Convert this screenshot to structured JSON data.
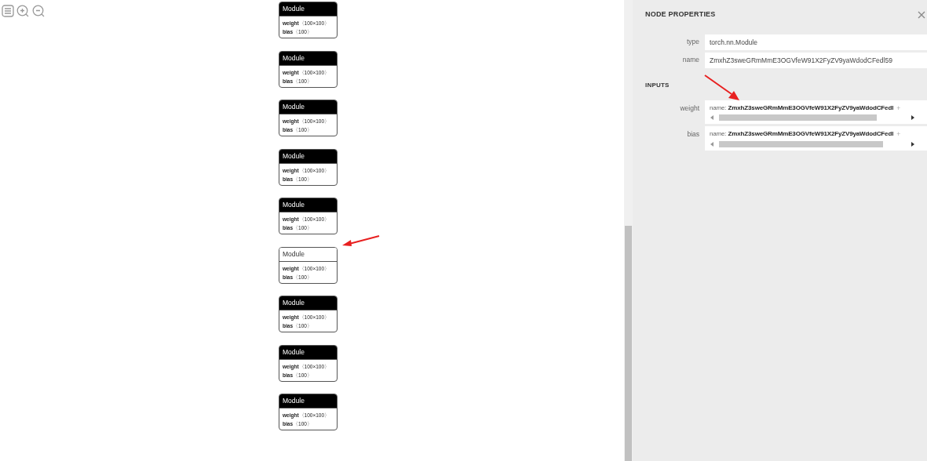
{
  "graph": {
    "nodes": [
      {
        "title": "Module",
        "selected": false,
        "attributes": [
          {
            "name": "weight",
            "value": "〈100×100〉"
          },
          {
            "name": "bias",
            "value": "〈100〉"
          }
        ]
      },
      {
        "title": "Module",
        "selected": false,
        "attributes": [
          {
            "name": "weight",
            "value": "〈100×100〉"
          },
          {
            "name": "bias",
            "value": "〈100〉"
          }
        ]
      },
      {
        "title": "Module",
        "selected": false,
        "attributes": [
          {
            "name": "weight",
            "value": "〈100×100〉"
          },
          {
            "name": "bias",
            "value": "〈100〉"
          }
        ]
      },
      {
        "title": "Module",
        "selected": false,
        "attributes": [
          {
            "name": "weight",
            "value": "〈100×100〉"
          },
          {
            "name": "bias",
            "value": "〈100〉"
          }
        ]
      },
      {
        "title": "Module",
        "selected": false,
        "attributes": [
          {
            "name": "weight",
            "value": "〈100×100〉"
          },
          {
            "name": "bias",
            "value": "〈100〉"
          }
        ]
      },
      {
        "title": "Module",
        "selected": true,
        "attributes": [
          {
            "name": "weight",
            "value": "〈100×100〉"
          },
          {
            "name": "bias",
            "value": "〈100〉"
          }
        ]
      },
      {
        "title": "Module",
        "selected": false,
        "attributes": [
          {
            "name": "weight",
            "value": "〈100×100〉"
          },
          {
            "name": "bias",
            "value": "〈100〉"
          }
        ]
      },
      {
        "title": "Module",
        "selected": false,
        "attributes": [
          {
            "name": "weight",
            "value": "〈100×100〉"
          },
          {
            "name": "bias",
            "value": "〈100〉"
          }
        ]
      },
      {
        "title": "Module",
        "selected": false,
        "attributes": [
          {
            "name": "weight",
            "value": "〈100×100〉"
          },
          {
            "name": "bias",
            "value": "〈100〉"
          }
        ]
      }
    ]
  },
  "panel": {
    "title": "NODE PROPERTIES",
    "properties": [
      {
        "label": "type",
        "value": "torch.nn.Module"
      },
      {
        "label": "name",
        "value": "ZmxhZ3sweGRmMmE3OGVfeW91X2FyZV9yaWdodCFedl59"
      }
    ],
    "inputs_title": "INPUTS",
    "inputs": [
      {
        "label": "weight",
        "key": "name:",
        "value": "ZmxhZ3sweGRmMmE3OGVfeW91X2FyZV9yaWdodCFedl",
        "expand": "+"
      },
      {
        "label": "bias",
        "key": "name:",
        "value": "ZmxhZ3sweGRmMmE3OGVfeW91X2FyZV9yaWdodCFedl",
        "expand": "+"
      }
    ]
  }
}
